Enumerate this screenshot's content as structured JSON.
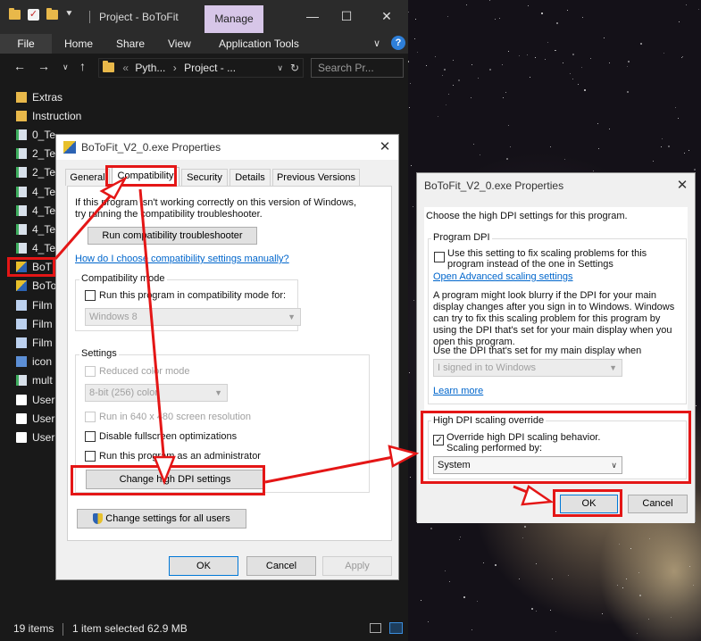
{
  "explorer": {
    "title": "Project - BoToFit",
    "manage_tab": "Manage",
    "ribbon": {
      "file": "File",
      "tabs": [
        "Home",
        "Share",
        "View",
        "Application Tools"
      ]
    },
    "address": {
      "crumb1": "Pyth...",
      "crumb2": "Project - ...",
      "prefix": "«"
    },
    "search_placeholder": "Search Pr...",
    "items": [
      {
        "name": "Extras",
        "icon": "folder-icon"
      },
      {
        "name": "Instruction",
        "icon": "folder-icon"
      },
      {
        "name": "0_Te",
        "icon": "python-file-icon"
      },
      {
        "name": "2_Te",
        "icon": "python-file-icon"
      },
      {
        "name": "2_Te",
        "icon": "python-file-icon"
      },
      {
        "name": "4_Te",
        "icon": "python-file-icon"
      },
      {
        "name": "4_Te",
        "icon": "python-file-icon"
      },
      {
        "name": "4_Te",
        "icon": "python-file-icon"
      },
      {
        "name": "4_Te",
        "icon": "python-file-icon"
      },
      {
        "name": "BoT",
        "icon": "exe-icon"
      },
      {
        "name": "BoTo",
        "icon": "exe-icon"
      },
      {
        "name": "Film",
        "icon": "video-file-icon"
      },
      {
        "name": "Film",
        "icon": "video-file-icon"
      },
      {
        "name": "Film",
        "icon": "video-file-icon"
      },
      {
        "name": "icon",
        "icon": "image-file-icon"
      },
      {
        "name": "mult",
        "icon": "python-file-icon"
      },
      {
        "name": "User",
        "icon": "text-file-icon"
      },
      {
        "name": "User",
        "icon": "text-file-icon"
      },
      {
        "name": "User",
        "icon": "text-file-icon"
      }
    ],
    "status": {
      "count": "19 items",
      "selected": "1 item selected  62.9 MB"
    }
  },
  "props_dialog": {
    "title": "BoToFit_V2_0.exe Properties",
    "tabs": [
      "General",
      "Compatibility",
      "Security",
      "Details",
      "Previous Versions"
    ],
    "intro": "If this program isn't working correctly on this version of Windows, try running the compatibility troubleshooter.",
    "run_troubleshooter": "Run compatibility troubleshooter",
    "manual_link": "How do I choose compatibility settings manually?",
    "compat_mode_label": "Compatibility mode",
    "compat_mode_checkbox": "Run this program in compatibility mode for:",
    "compat_mode_select": "Windows 8",
    "settings_label": "Settings",
    "reduced_color": "Reduced color mode",
    "color_select": "8-bit (256) color",
    "run_640": "Run in 640 x 480 screen resolution",
    "disable_fullscreen": "Disable fullscreen optimizations",
    "run_admin": "Run this program as an administrator",
    "change_dpi": "Change high DPI settings",
    "change_all_users": "Change settings for all users",
    "ok": "OK",
    "cancel": "Cancel",
    "apply": "Apply"
  },
  "dpi_dialog": {
    "title": "BoToFit_V2_0.exe Properties",
    "header": "Choose the high DPI settings for this program.",
    "program_dpi_label": "Program DPI",
    "program_dpi_checkbox": "Use this setting to fix scaling problems for this program instead of the one in Settings",
    "advanced_link": "Open Advanced scaling settings",
    "blurry_text": "A program might look blurry if the DPI for your main display changes after you sign in to Windows. Windows can try to fix this scaling problem for this program by using the DPI that's set for your main display when you open this program.",
    "use_dpi_label": "Use the DPI that's set for my main display when",
    "signin_select": "I signed in to Windows",
    "learn_more": "Learn more",
    "override_label": "High DPI scaling override",
    "override_checkbox": "Override high DPI scaling behavior.",
    "scaling_by": "Scaling performed by:",
    "scaling_select": "System",
    "ok": "OK",
    "cancel": "Cancel"
  },
  "colors": {
    "annotation": "#e41616",
    "explorer_bg": "#191919",
    "manage_tab": "#d7c6e8",
    "link": "#0066cc"
  }
}
